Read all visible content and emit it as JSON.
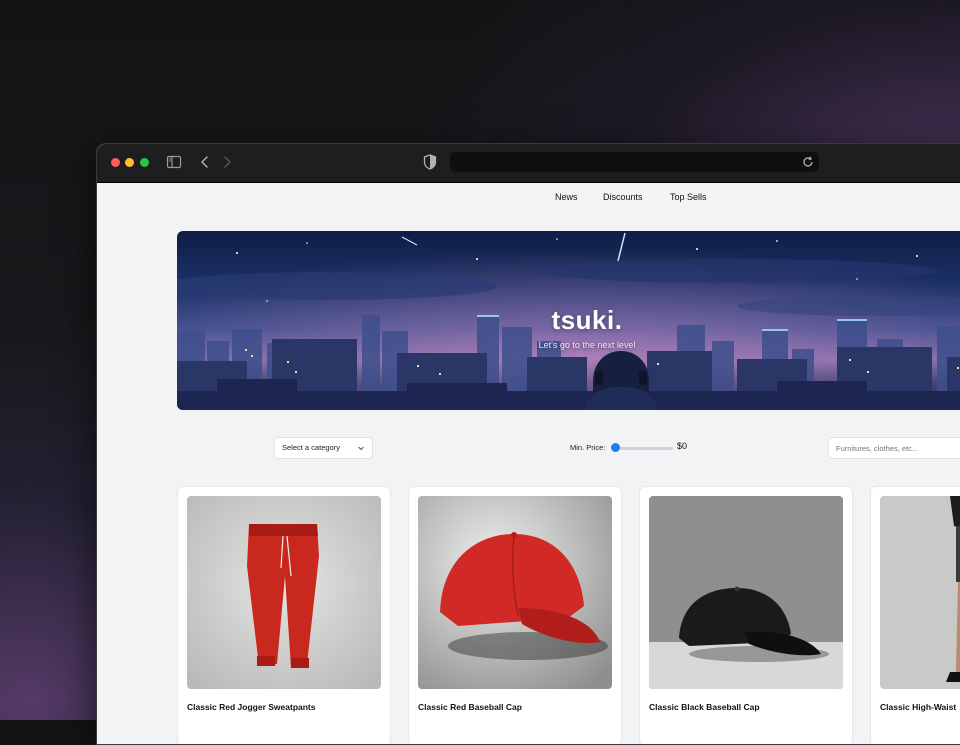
{
  "nav": {
    "links": [
      "News",
      "Discounts",
      "Top Sells"
    ]
  },
  "hero": {
    "title": "tsuki.",
    "subtitle": "Let's go to the next level"
  },
  "filters": {
    "category_placeholder": "Select a category",
    "min_price_label": "Min. Price:",
    "min_price_value": "$0",
    "search_placeholder": "Furnitures, clothes, etc..."
  },
  "products": [
    {
      "name": "Classic Red Jogger Sweatpants",
      "image": "red-sweatpants"
    },
    {
      "name": "Classic Red Baseball Cap",
      "image": "red-baseball-cap"
    },
    {
      "name": "Classic Black Baseball Cap",
      "image": "black-baseball-cap"
    },
    {
      "name": "Classic High-Waist",
      "image": "model-shorts"
    }
  ],
  "colors": {
    "accent": "#1e7cf2",
    "page_bg": "#f2f3f5",
    "titlebar": "#1e1e20"
  }
}
